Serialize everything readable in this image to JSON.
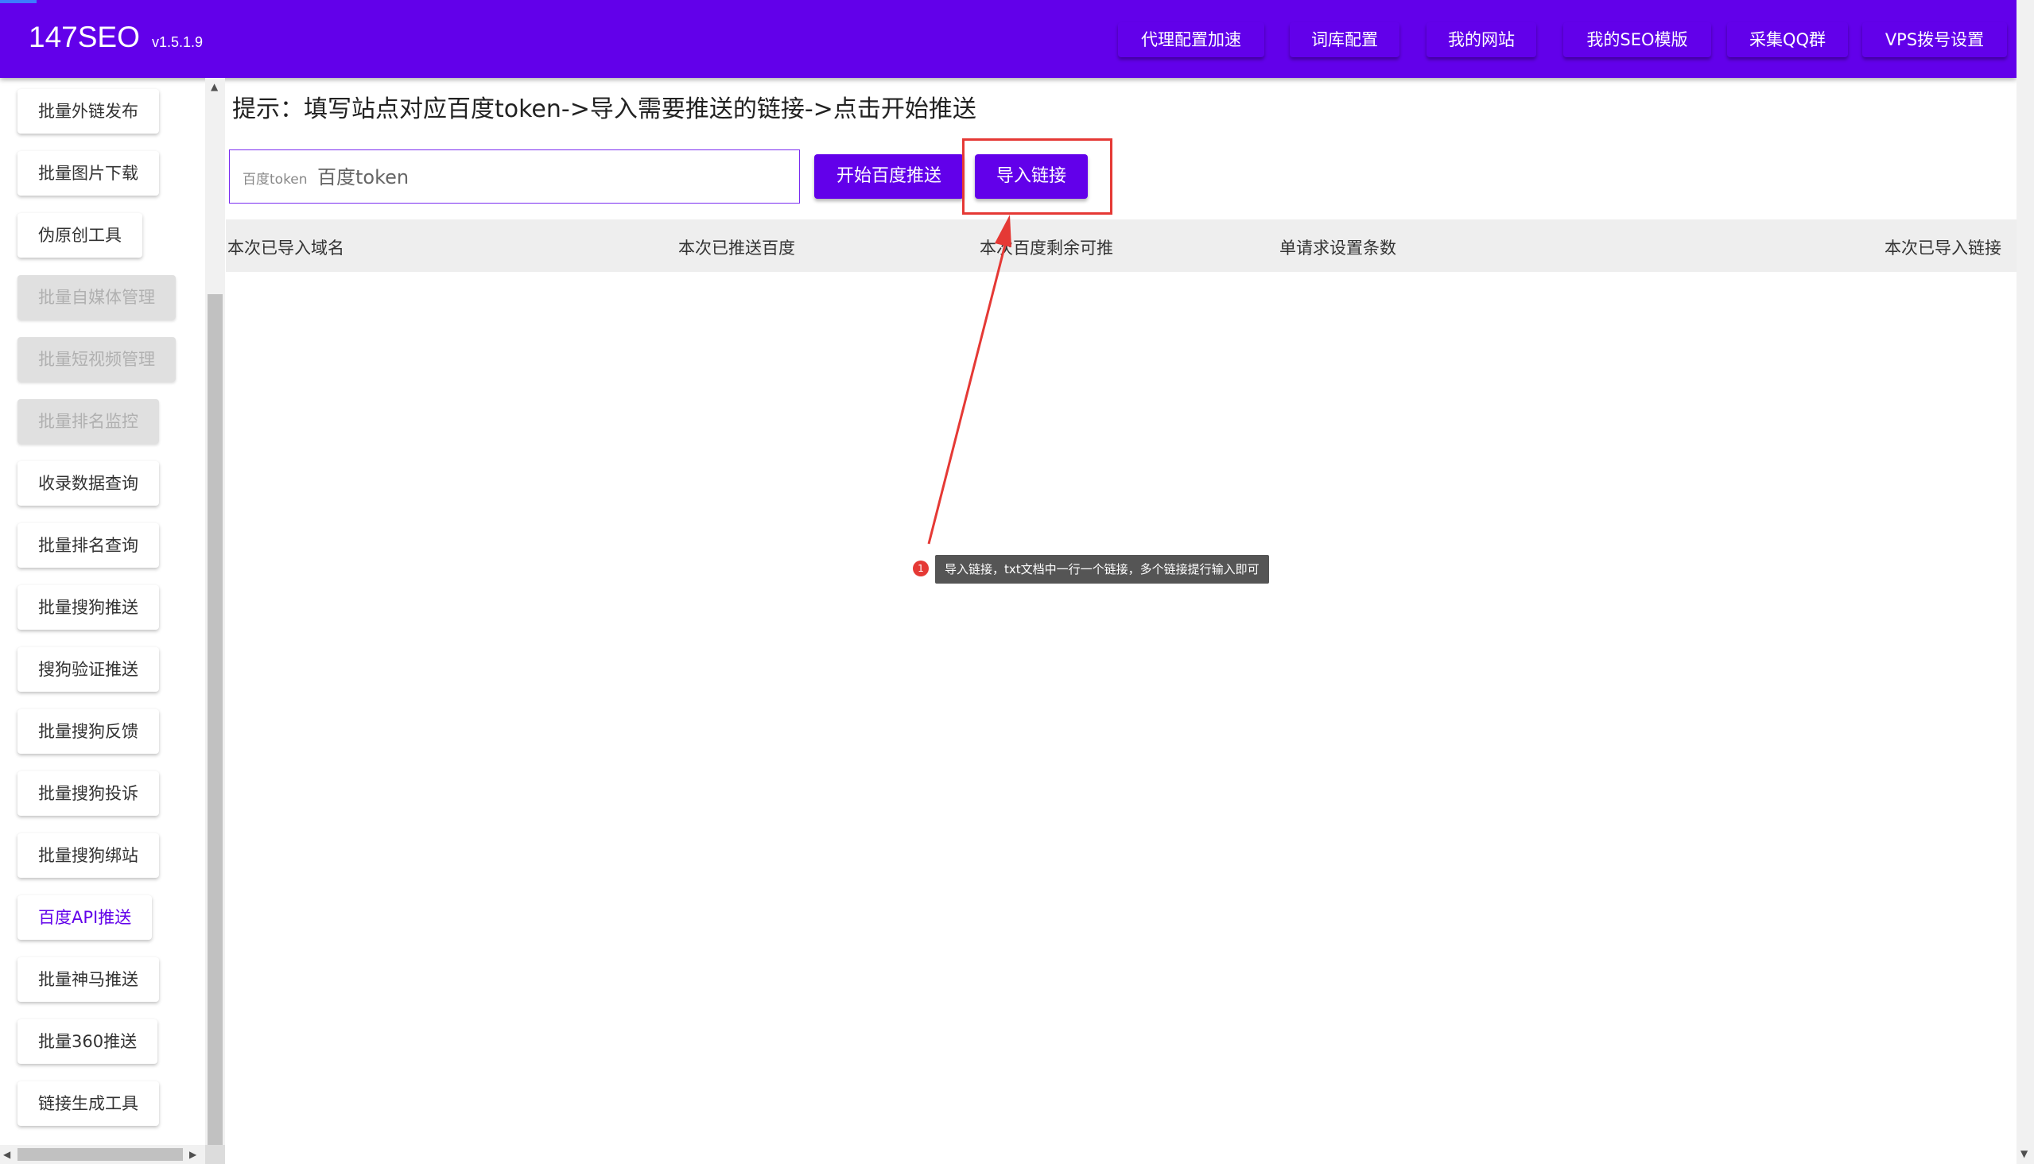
{
  "app": {
    "name": "147SEO",
    "version": "v1.5.1.9"
  },
  "header": {
    "buttons": [
      {
        "label": "代理配置加速"
      },
      {
        "label": "词库配置"
      },
      {
        "label": "我的网站"
      },
      {
        "label": "我的SEO模版"
      },
      {
        "label": "采集QQ群"
      },
      {
        "label": "VPS拨号设置"
      }
    ]
  },
  "sidebar": {
    "items": [
      {
        "label": "批量外链发布",
        "state": "normal"
      },
      {
        "label": "批量图片下载",
        "state": "normal"
      },
      {
        "label": "伪原创工具",
        "state": "normal"
      },
      {
        "label": "批量自媒体管理",
        "state": "disabled"
      },
      {
        "label": "批量短视频管理",
        "state": "disabled"
      },
      {
        "label": "批量排名监控",
        "state": "disabled"
      },
      {
        "label": "收录数据查询",
        "state": "normal"
      },
      {
        "label": "批量排名查询",
        "state": "normal"
      },
      {
        "label": "批量搜狗推送",
        "state": "normal"
      },
      {
        "label": "搜狗验证推送",
        "state": "normal"
      },
      {
        "label": "批量搜狗反馈",
        "state": "normal"
      },
      {
        "label": "批量搜狗投诉",
        "state": "normal"
      },
      {
        "label": "批量搜狗绑站",
        "state": "normal"
      },
      {
        "label": "百度API推送",
        "state": "active"
      },
      {
        "label": "批量神马推送",
        "state": "normal"
      },
      {
        "label": "批量360推送",
        "state": "normal"
      },
      {
        "label": "链接生成工具",
        "state": "normal"
      }
    ]
  },
  "main": {
    "hint": "提示：填写站点对应百度token->导入需要推送的链接->点击开始推送",
    "token": {
      "label": "百度token",
      "placeholder": "百度token",
      "value": ""
    },
    "start_button": "开始百度推送",
    "import_button": "导入链接",
    "table": {
      "columns": [
        "本次已导入域名",
        "本次已推送百度",
        "本次百度剩余可推",
        "单请求设置条数",
        "本次已导入链接"
      ],
      "rows": []
    }
  },
  "annotation": {
    "marker": "1",
    "text": "导入链接，txt文档中一行一个链接，多个链接提行输入即可",
    "color": "#e53935"
  },
  "colors": {
    "primary": "#6200ea",
    "disabled_bg": "#e0e0e0",
    "annotation": "#e53935"
  }
}
